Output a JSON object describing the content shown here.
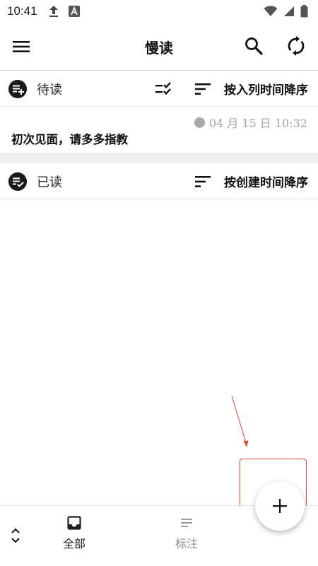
{
  "status_bar": {
    "time": "10:41",
    "icons": [
      "upload-icon",
      "font-app-icon",
      "wifi-icon",
      "signal-icon",
      "battery-icon"
    ]
  },
  "app_bar": {
    "title": "慢读",
    "icons": [
      "menu-icon",
      "search-icon",
      "sync-icon"
    ]
  },
  "sections": {
    "unread": {
      "label": "待读",
      "sort_label": "按入列时间降序",
      "items": [
        {
          "date": "04 月 15 日 10:32",
          "title": "初次见面，请多多指教"
        }
      ]
    },
    "read": {
      "label": "已读",
      "sort_label": "按创建时间降序"
    }
  },
  "fab": {
    "icon": "plus-icon"
  },
  "bottom_nav": {
    "items": [
      {
        "label": "全部",
        "icon": "inbox-icon",
        "active": true
      },
      {
        "label": "标注",
        "icon": "notes-icon",
        "active": false
      }
    ]
  },
  "colors": {
    "annotation": "#d84a3a",
    "muted": "#a4a4a4"
  }
}
